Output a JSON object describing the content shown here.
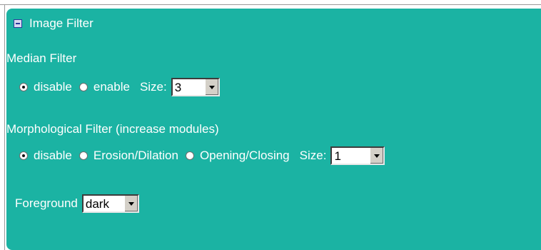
{
  "panel": {
    "title": "Image Filter"
  },
  "median": {
    "label": "Median Filter",
    "options": [
      "disable",
      "enable"
    ],
    "selected": "disable",
    "size_label": "Size:",
    "size_value": "3"
  },
  "morph": {
    "label": "Morphological Filter (increase modules)",
    "options": [
      "disable",
      "Erosion/Dilation",
      "Opening/Closing"
    ],
    "selected": "disable",
    "size_label": "Size:",
    "size_value": "1"
  },
  "foreground": {
    "label": "Foreground",
    "value": "dark"
  },
  "colors": {
    "panel_bg": "#1bb3a3",
    "text": "#ffffff"
  }
}
